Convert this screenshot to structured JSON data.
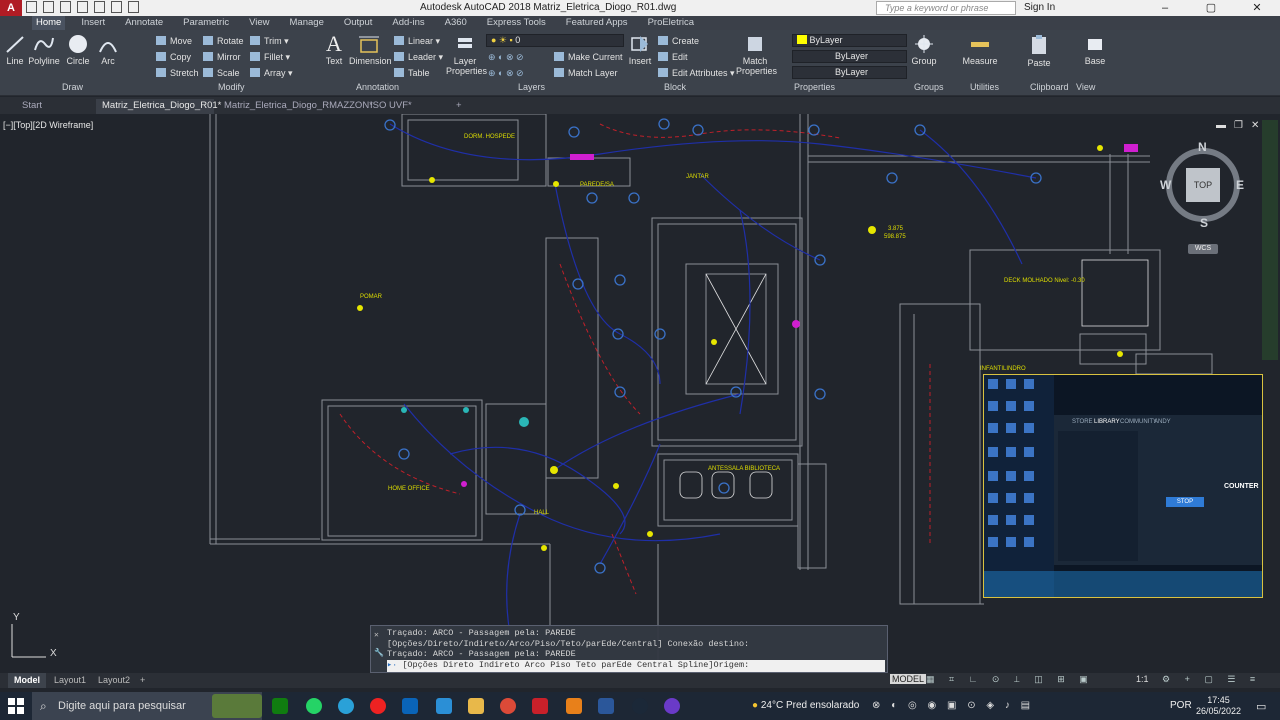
{
  "window": {
    "title": "Autodesk AutoCAD 2018    Matriz_Eletrica_Diogo_R01.dwg",
    "search_placeholder": "Type a keyword or phrase",
    "sign_in": "Sign In",
    "logo": "A"
  },
  "menu_tabs": [
    "Home",
    "Insert",
    "Annotate",
    "Parametric",
    "View",
    "Manage",
    "Output",
    "Add-ins",
    "A360",
    "Express Tools",
    "Featured Apps",
    "ProEletrica"
  ],
  "ribbon": {
    "draw": {
      "line": "Line",
      "polyline": "Polyline",
      "circle": "Circle",
      "arc": "Arc",
      "label": "Draw"
    },
    "modify": {
      "move": "Move",
      "copy": "Copy",
      "stretch": "Stretch",
      "rotate": "Rotate",
      "mirror": "Mirror",
      "scale": "Scale",
      "trim": "Trim",
      "fillet": "Fillet",
      "array": "Array",
      "label": "Modify"
    },
    "annotation": {
      "text": "Text",
      "dimension": "Dimension",
      "linear": "Linear",
      "leader": "Leader",
      "table": "Table",
      "label": "Annotation"
    },
    "layers": {
      "layer_properties": "Layer Properties",
      "layer_value": "0",
      "make_current": "Make Current",
      "match_layer": "Match Layer",
      "label": "Layers"
    },
    "block": {
      "insert": "Insert",
      "create": "Create",
      "edit": "Edit",
      "edit_attributes": "Edit Attributes",
      "label": "Block"
    },
    "properties": {
      "match_properties": "Match Properties",
      "color": "ByLayer",
      "linetype": "ByLayer",
      "lineweight": "ByLayer",
      "label": "Properties"
    },
    "groups": {
      "group": "Group",
      "label": "Groups"
    },
    "utilities": {
      "measure": "Measure",
      "label": "Utilities"
    },
    "clipboard": {
      "paste": "Paste",
      "label": "Clipboard"
    },
    "view": {
      "base": "Base",
      "label": "View"
    }
  },
  "file_tabs": [
    "Start",
    "Matriz_Eletrica_Diogo_R01*",
    "Matriz_Eletrica_Diogo_RMAZZON*",
    "ISO UVF*"
  ],
  "viewport": {
    "label": "[−][Top][2D Wireframe]",
    "compass": {
      "n": "N",
      "s": "S",
      "e": "E",
      "w": "W",
      "top": "TOP",
      "wcs": "WCS"
    },
    "ucs_x": "X",
    "ucs_y": "Y"
  },
  "drawing_labels": {
    "dorm": "DORM. HOSPEDE",
    "parade": "PAREDE/SA",
    "jantar": "JANTAR",
    "pomar": "POMAR",
    "deck": "DECK MOLHADO Nivel: -0.30",
    "infantil": "INFANTILINDRO",
    "home_office": "HOME OFFICE",
    "antessala": "ANTESSALA BIBLIOTECA",
    "hall": "HALL",
    "coord": "3.875",
    "coord2": "598.875"
  },
  "command_line": {
    "line1": "Traçado: ARCO  -  Passagem pela: PAREDE",
    "line2": "[Opções/Direto/Indireto/Arco/Piso/Teto/parEde/Central] Conexão destino:",
    "line3": "Traçado: ARCO  -  Passagem pela: PAREDE",
    "prompt": "[Opções Direto Indireto Arco Piso Teto parEde Central Spline]Origem:"
  },
  "layout_tabs": [
    "Model",
    "Layout1",
    "Layout2"
  ],
  "status": {
    "model": "MODEL",
    "scale": "1:1"
  },
  "popup": {
    "store": "STORE",
    "library": "LIBRARY",
    "community": "COMMUNITY",
    "user": "ANDY",
    "stop": "STOP",
    "game": "COUNTER"
  },
  "taskbar": {
    "search": "Digite aqui para pesquisar",
    "weather": "24°C  Pred ensolarado",
    "lang": "POR",
    "time": "17:45",
    "date": "26/05/2022"
  }
}
